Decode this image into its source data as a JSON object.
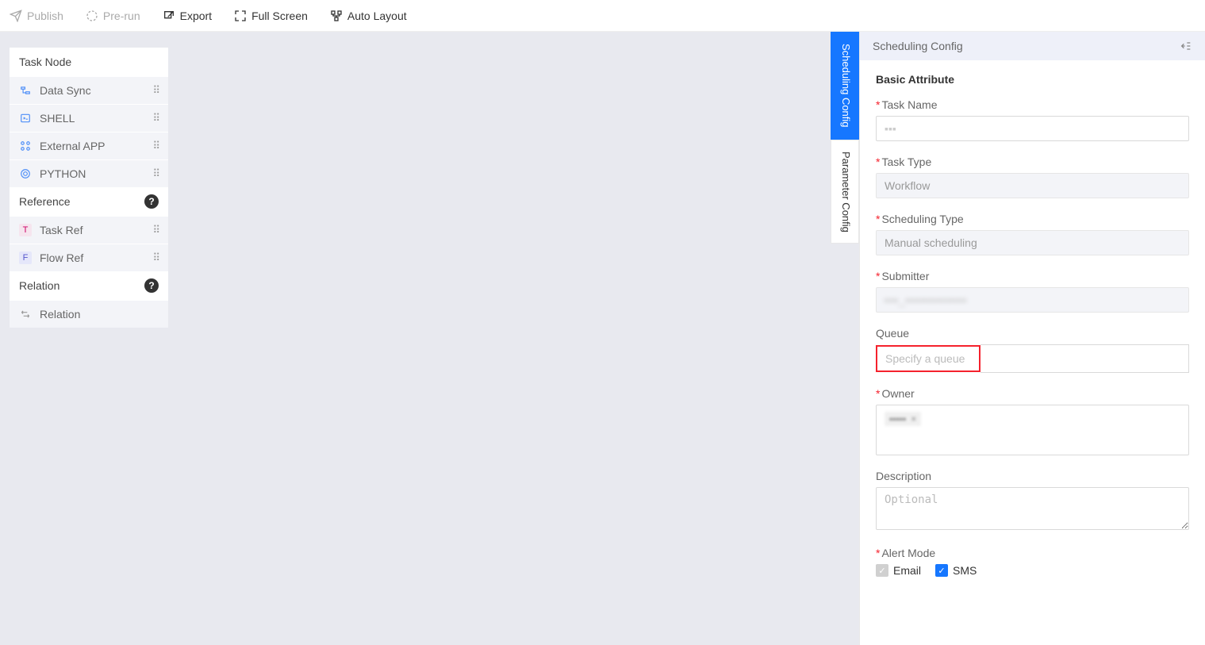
{
  "toolbar": {
    "publish": "Publish",
    "prerun": "Pre-run",
    "export": "Export",
    "fullscreen": "Full Screen",
    "autolayout": "Auto Layout"
  },
  "left_panel": {
    "task_node_header": "Task Node",
    "items": [
      {
        "label": "Data Sync"
      },
      {
        "label": "SHELL"
      },
      {
        "label": "External APP"
      },
      {
        "label": "PYTHON"
      }
    ],
    "reference_header": "Reference",
    "ref_items": [
      {
        "badge": "T",
        "label": "Task Ref"
      },
      {
        "badge": "F",
        "label": "Flow Ref"
      }
    ],
    "relation_header": "Relation",
    "relation_item": "Relation"
  },
  "right_tabs": {
    "scheduling": "Scheduling Config",
    "parameter": "Parameter Config"
  },
  "right_panel": {
    "header": "Scheduling Config",
    "basic_attribute": "Basic Attribute",
    "fields": {
      "task_name_label": "Task Name",
      "task_name_value": "▪▪▪",
      "task_type_label": "Task Type",
      "task_type_value": "Workflow",
      "scheduling_type_label": "Scheduling Type",
      "scheduling_type_value": "Manual scheduling",
      "submitter_label": "Submitter",
      "submitter_value": "▪▪▪_▪▪▪▪▪▪▪▪▪▪▪▪▪",
      "queue_label": "Queue",
      "queue_placeholder": "Specify a queue",
      "owner_label": "Owner",
      "owner_tag": "▪▪▪▪▪",
      "description_label": "Description",
      "description_placeholder": "Optional",
      "alert_mode_label": "Alert Mode",
      "email_label": "Email",
      "sms_label": "SMS"
    }
  }
}
